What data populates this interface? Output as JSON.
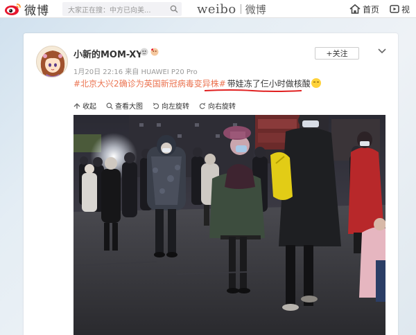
{
  "topnav": {
    "logo_text": "微博",
    "search_placeholder": "大家正在搜：中方已向美...",
    "brand_latin": "weibo",
    "brand_cn": "微博",
    "home_label": "首页",
    "video_label": "视"
  },
  "post": {
    "username": "小新的MOM-XY",
    "time": "1月20日 22:16",
    "source_prefix": "来自",
    "source": "HUAWEI P20 Pro",
    "follow_label": "+关注",
    "hashtag": "#北京大兴2确诊为英国新冠病毒变异株#",
    "body": "带娃冻了仨小时做核酸",
    "emoji_name": "cold-face-emoji"
  },
  "toolbar": {
    "collect": "收起",
    "view_large": "查看大图",
    "rotate_left": "向左旋转",
    "rotate_right": "向右旋转"
  },
  "colors": {
    "hashtag": "#eb7350",
    "accent": "#ff8200",
    "underline": "#e02020"
  },
  "icons": [
    "weibo-eye-icon",
    "search-icon",
    "home-icon",
    "video-icon",
    "chevron-down-icon",
    "collect-icon",
    "zoom-icon",
    "rotate-left-icon",
    "rotate-right-icon"
  ]
}
